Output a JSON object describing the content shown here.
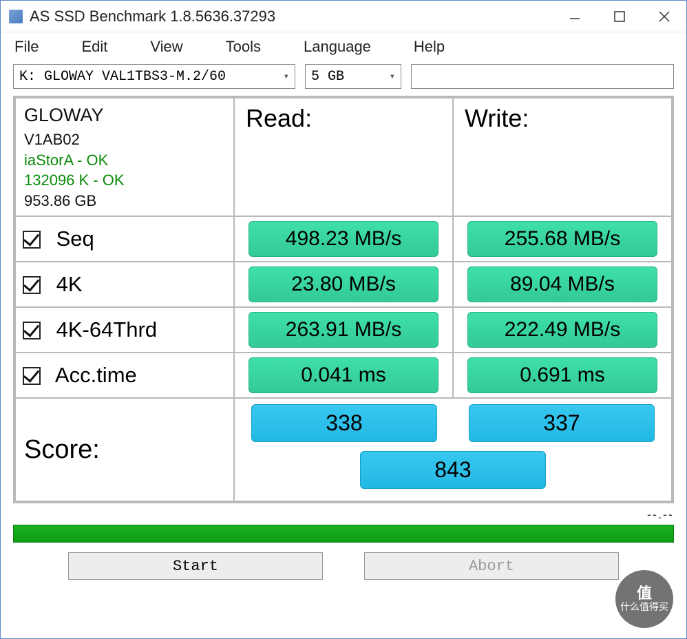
{
  "window": {
    "title": "AS SSD Benchmark 1.8.5636.37293"
  },
  "menu": {
    "file": "File",
    "edit": "Edit",
    "view": "View",
    "tools": "Tools",
    "language": "Language",
    "help": "Help"
  },
  "toolbar": {
    "drive": "K: GLOWAY VAL1TBS3-M.2/60",
    "size": "5 GB"
  },
  "info": {
    "name": "GLOWAY",
    "firmware": "V1AB02",
    "driver_status": "iaStorA - OK",
    "align_status": "132096 K - OK",
    "capacity": "953.86 GB"
  },
  "headers": {
    "read": "Read:",
    "write": "Write:"
  },
  "rows": {
    "seq": {
      "label": "Seq",
      "read": "498.23 MB/s",
      "write": "255.68 MB/s"
    },
    "k4": {
      "label": "4K",
      "read": "23.80 MB/s",
      "write": "89.04 MB/s"
    },
    "k464": {
      "label": "4K-64Thrd",
      "read": "263.91 MB/s",
      "write": "222.49 MB/s"
    },
    "acc": {
      "label": "Acc.time",
      "read": "0.041 ms",
      "write": "0.691 ms"
    }
  },
  "score": {
    "label": "Score:",
    "read": "338",
    "write": "337",
    "total": "843"
  },
  "status_text": "--.--",
  "buttons": {
    "start": "Start",
    "abort": "Abort"
  },
  "watermark": {
    "top": "值",
    "bottom": "什么值得买"
  }
}
